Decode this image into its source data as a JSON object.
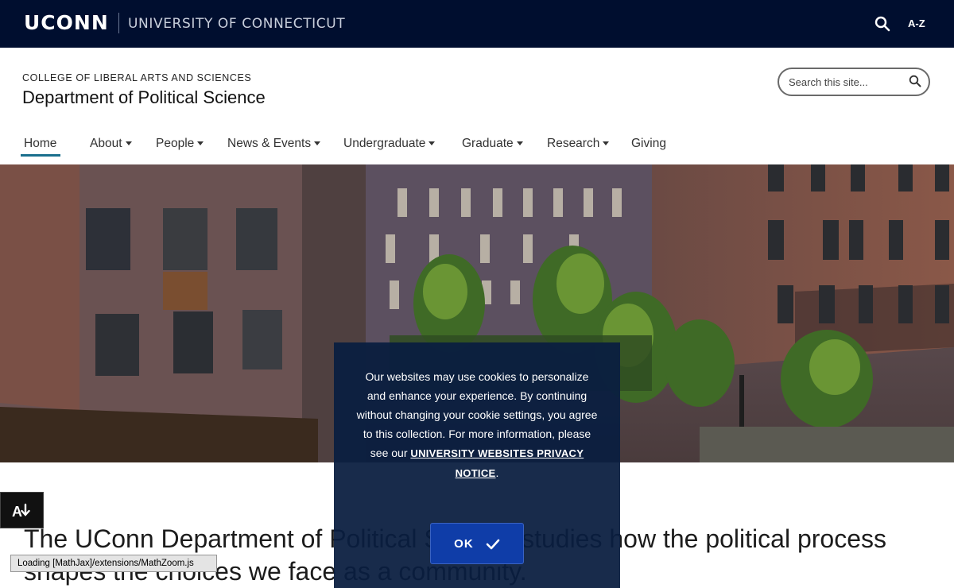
{
  "topbar": {
    "wordmark": "UCONN",
    "university_name": "UNIVERSITY OF CONNECTICUT",
    "search_icon": "search-icon",
    "az_label": "A-Z"
  },
  "header": {
    "college": "COLLEGE OF LIBERAL ARTS AND SCIENCES",
    "department": "Department of Political Science",
    "search_placeholder": "Search this site...",
    "search_icon": "search-icon"
  },
  "nav": {
    "items": [
      {
        "label": "Home",
        "active": true,
        "dropdown": false
      },
      {
        "label": "About",
        "dropdown": true
      },
      {
        "label": "People",
        "dropdown": true
      },
      {
        "label": "News & Events",
        "dropdown": true
      },
      {
        "label": "Undergraduate",
        "dropdown": true
      },
      {
        "label": "Graduate",
        "dropdown": true
      },
      {
        "label": "Research",
        "dropdown": true
      },
      {
        "label": "Giving",
        "dropdown": false
      }
    ]
  },
  "intro": {
    "text": "The UConn Department of Political Science studies how the political process shapes the choices we face as a community."
  },
  "cookie": {
    "text": "Our websites may use cookies to personalize and enhance your experience. By continuing without changing your cookie settings, you agree to this collection. For more information, please see our",
    "link_label": "UNIVERSITY WEBSITES PRIVACY NOTICE",
    "after_link": ".",
    "ok_label": "OK",
    "ok_icon": "check-icon"
  },
  "accessibility": {
    "icon": "accessibility-download-icon"
  },
  "mathjax": {
    "status": "Loading [MathJax]/extensions/MathZoom.js"
  },
  "colors": {
    "topbar": "#000e2f",
    "accent": "#1a6f8d",
    "cookie_bg": "#0a1e40",
    "ok_button": "#0f3da8"
  }
}
